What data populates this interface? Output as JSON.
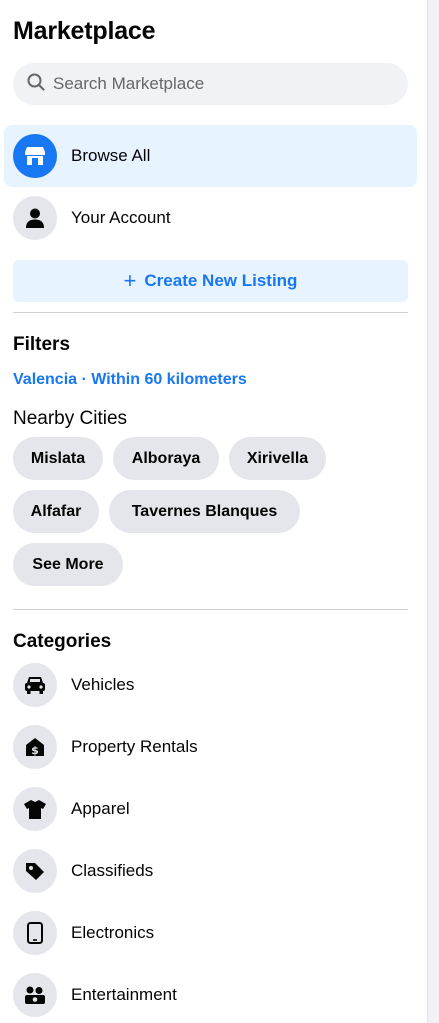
{
  "header": {
    "title": "Marketplace"
  },
  "search": {
    "placeholder": "Search Marketplace",
    "value": ""
  },
  "nav": [
    {
      "label": "Browse All",
      "icon": "storefront-icon",
      "active": true
    },
    {
      "label": "Your Account",
      "icon": "person-icon",
      "active": false
    }
  ],
  "create_listing": {
    "label": "Create New Listing",
    "icon": "plus-icon"
  },
  "filters": {
    "heading": "Filters",
    "location": "Valencia · Within 60 kilometers",
    "nearby_heading": "Nearby Cities",
    "cities": [
      "Mislata",
      "Alboraya",
      "Xirivella",
      "Alfafar",
      "Tavernes Blanques"
    ],
    "see_more": "See More"
  },
  "categories": {
    "heading": "Categories",
    "items": [
      {
        "label": "Vehicles",
        "icon": "car-icon"
      },
      {
        "label": "Property Rentals",
        "icon": "house-dollar-icon"
      },
      {
        "label": "Apparel",
        "icon": "shirt-icon"
      },
      {
        "label": "Classifieds",
        "icon": "tag-icon"
      },
      {
        "label": "Electronics",
        "icon": "phone-icon"
      },
      {
        "label": "Entertainment",
        "icon": "people-icon"
      }
    ]
  },
  "colors": {
    "accent": "#1877f2",
    "active_bg": "#e7f3ff",
    "chip_bg": "#e4e6eb",
    "search_bg": "#f0f2f5"
  }
}
